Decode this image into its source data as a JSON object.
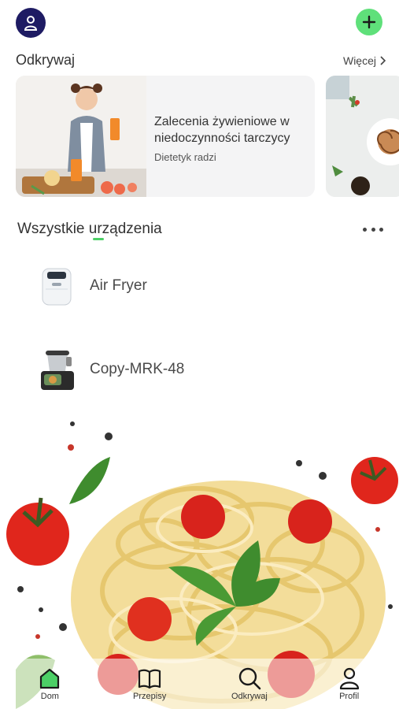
{
  "header": {
    "avatar_icon": "user-icon",
    "add_icon": "plus-icon",
    "colors": {
      "avatar_bg": "#1e1b63",
      "add_bg": "#5fe07a"
    }
  },
  "discover": {
    "title": "Odkrywaj",
    "more_label": "Więcej",
    "cards": [
      {
        "title": "Zalecenia żywieniowe w niedoczynności tarczycy",
        "subtitle": "Dietetyk radzi"
      }
    ]
  },
  "devices": {
    "title": "Wszystkie urządzenia",
    "more_icon": "more-dots-icon",
    "items": [
      {
        "name": "Air Fryer",
        "icon": "air-fryer-icon"
      },
      {
        "name": "Copy-MRK-48",
        "icon": "food-processor-icon"
      }
    ]
  },
  "nav": {
    "items": [
      {
        "label": "Dom",
        "icon": "home-icon",
        "active": true
      },
      {
        "label": "Przepisy",
        "icon": "book-icon",
        "active": false
      },
      {
        "label": "Odkrywaj",
        "icon": "search-icon",
        "active": false
      },
      {
        "label": "Profil",
        "icon": "profile-icon",
        "active": false
      }
    ],
    "accent": "#4ccf66"
  }
}
